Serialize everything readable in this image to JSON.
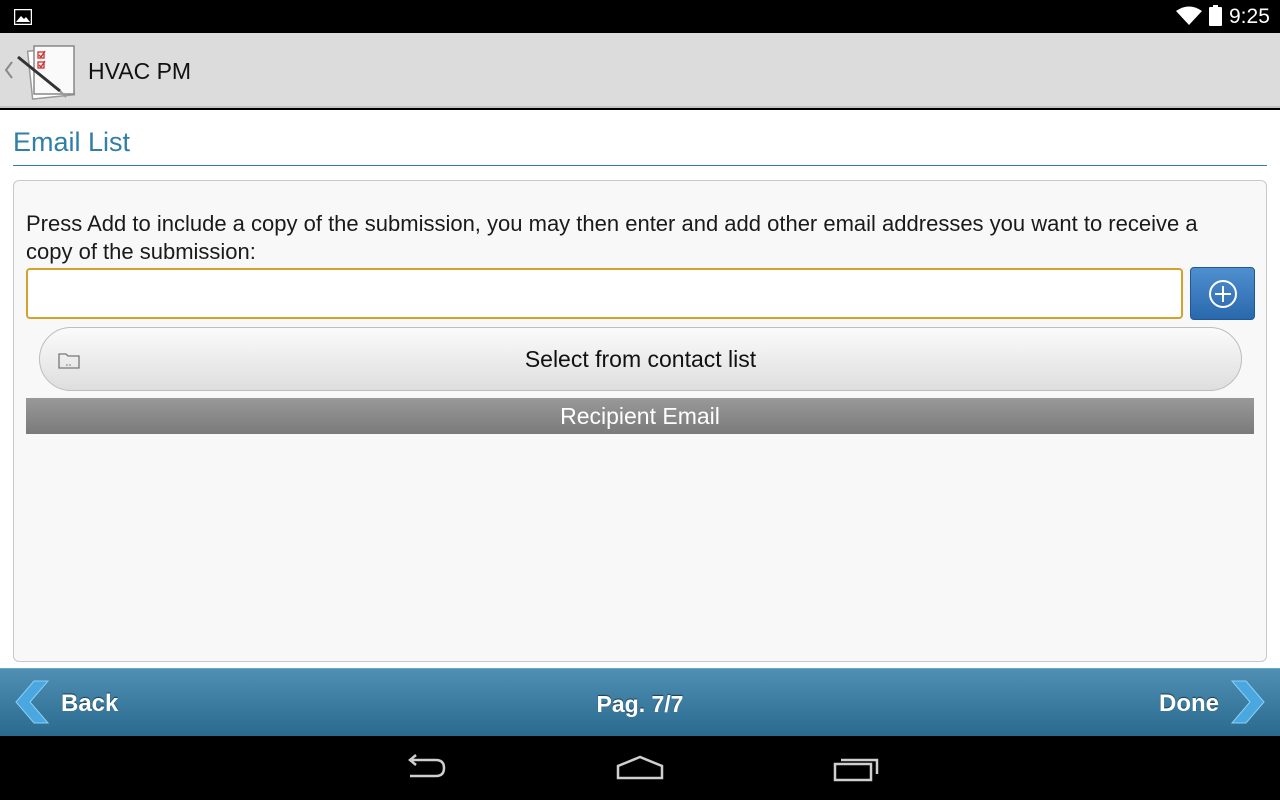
{
  "status_bar": {
    "time": "9:25",
    "icons": [
      "image-notification-icon",
      "wifi-icon",
      "battery-icon"
    ]
  },
  "action_bar": {
    "title": "HVAC PM",
    "icons": [
      "up-caret-icon",
      "checklist-app-icon"
    ]
  },
  "page": {
    "section_title": "Email List",
    "instructions": "Press Add to include a copy of the submission, you may then enter and add other email addresses you want to receive a copy of the submission:",
    "email_input": {
      "value": "",
      "placeholder": ""
    },
    "add_button_icon": "plus-circle-icon",
    "contact_button_label": "Select from contact list",
    "contact_button_icon": "folder-icon",
    "recipient_header": "Recipient Email"
  },
  "nav": {
    "back_label": "Back",
    "page_indicator": "Pag. 7/7",
    "done_label": "Done"
  },
  "system_nav": {
    "icons": [
      "back-icon",
      "home-icon",
      "recent-apps-icon"
    ]
  },
  "colors": {
    "accent": "#2f7fa6",
    "input_border": "#d4a12a",
    "nav_bar": "#3b7da2",
    "add_button": "#3a7bbf"
  }
}
